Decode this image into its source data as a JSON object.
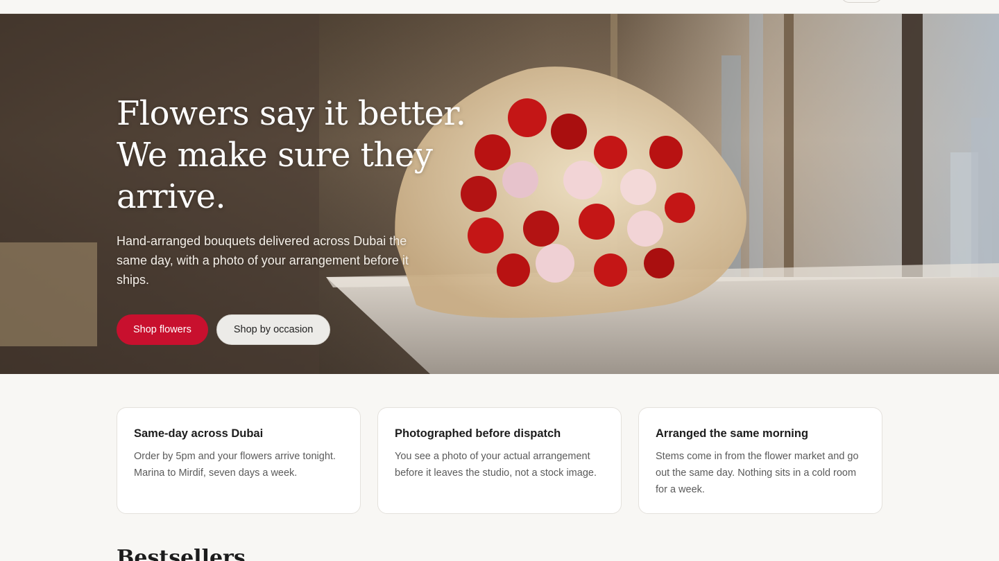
{
  "hero": {
    "title": "Flowers say it better. We make sure they arrive.",
    "subtitle": "Hand-arranged bouquets delivered across Dubai the same day, with a photo of your arrangement before it ships.",
    "primary_button": "Shop flowers",
    "secondary_button": "Shop by occasion"
  },
  "features": [
    {
      "title": "Same-day across Dubai",
      "text": "Order by 5pm and your flowers arrive tonight. Marina to Mirdif, seven days a week."
    },
    {
      "title": "Photographed before dispatch",
      "text": "You see a photo of your actual arrangement before it leaves the studio, not a stock image."
    },
    {
      "title": "Arranged the same morning",
      "text": "Stems come in from the flower market and go out the same day. Nothing sits in a cold room for a week."
    }
  ],
  "bestsellers": {
    "heading": "Bestsellers"
  },
  "colors": {
    "accent": "#c8102e",
    "background": "#f8f7f4",
    "card": "#ffffff"
  }
}
